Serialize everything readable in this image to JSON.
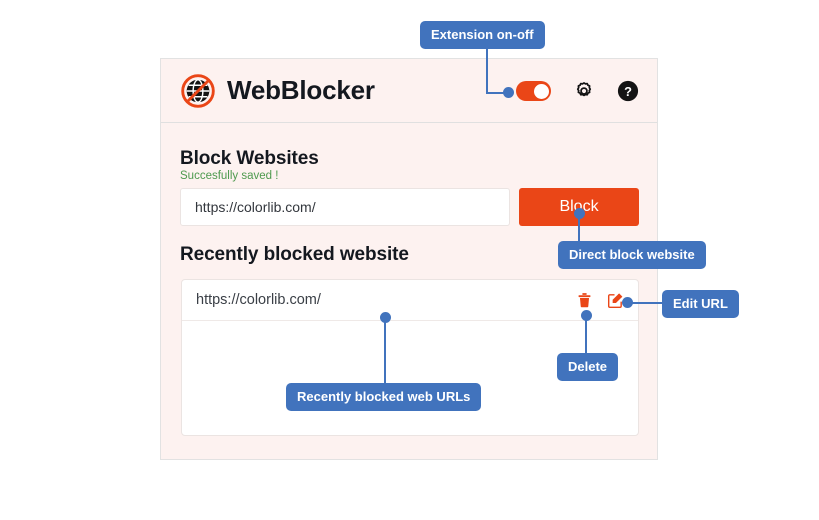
{
  "app": {
    "name": "WebBlocker",
    "logo_icon": "blocked-globe-icon"
  },
  "header": {
    "toggle": {
      "name": "extension-power-toggle",
      "state": "on"
    },
    "settings_icon": "gear-icon",
    "help_icon": "question-mark-icon"
  },
  "block_section": {
    "title": "Block Websites",
    "status_message": "Succesfully saved !",
    "input_value": "https://colorlib.com/",
    "input_placeholder": "https://colorlib.com/",
    "button_label": "Block"
  },
  "recent_section": {
    "title": "Recently blocked website",
    "rows": [
      {
        "url": "https://colorlib.com/",
        "delete_icon": "trash-icon",
        "edit_icon": "pencil-square-icon"
      }
    ]
  },
  "annotations": [
    {
      "id": "extension-on-off",
      "label": "Extension on-off"
    },
    {
      "id": "direct-block-website",
      "label": "Direct block website"
    },
    {
      "id": "edit-url",
      "label": "Edit URL"
    },
    {
      "id": "delete",
      "label": "Delete"
    },
    {
      "id": "recently-blocked-web-urls",
      "label": "Recently blocked web URLs"
    }
  ],
  "colors": {
    "accent": "#ea4617",
    "annotation": "#4173bd",
    "card_background": "#fdf2f0",
    "success_text": "#4e9a4e"
  }
}
